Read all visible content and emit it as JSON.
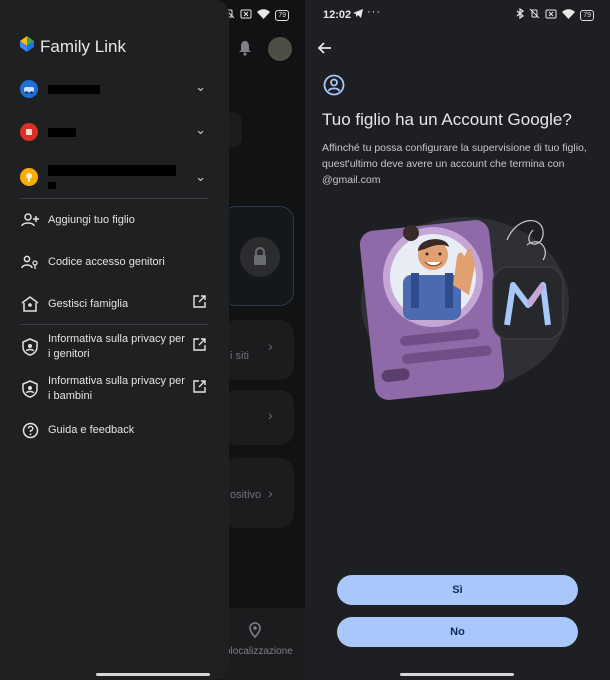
{
  "status_bar": {
    "time": "12:02",
    "battery": "79"
  },
  "left": {
    "app_name": "Family Link",
    "menu": [
      {
        "label": "Aggiungi tuo figlio",
        "icon": "person-add-icon",
        "external": false
      },
      {
        "label": "Codice accesso genitori",
        "icon": "people-key-icon",
        "external": false
      },
      {
        "label": "Gestisci famiglia",
        "icon": "family-home-icon",
        "external": true
      },
      {
        "label": "Informativa sulla privacy per i genitori",
        "icon": "shield-person-icon",
        "external": true
      },
      {
        "label": "Informativa sulla privacy per i bambini",
        "icon": "shield-person-icon",
        "external": true
      },
      {
        "label": "Guida e feedback",
        "icon": "help-icon",
        "external": false
      }
    ],
    "background": {
      "item1_text": "i siti",
      "item2_text": "ositivo",
      "bottom_nav_label": "olocalizzazione"
    }
  },
  "right": {
    "title": "Tuo figlio ha un Account Google?",
    "description": "Affinché tu possa configurare la supervisione di tuo figlio, quest'ultimo deve avere un account che termina con @gmail.com",
    "yes_button": "Sì",
    "no_button": "No"
  },
  "colors": {
    "button": "#a8c7fa",
    "drawer": "#1e2022",
    "background": "#1e1f22"
  }
}
